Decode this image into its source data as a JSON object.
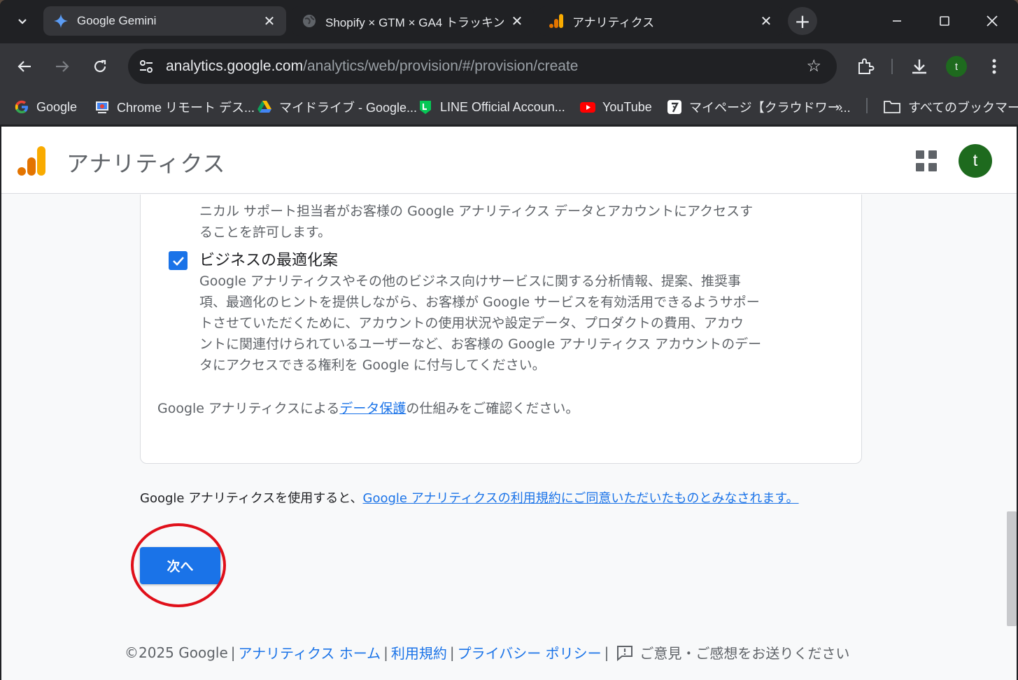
{
  "tabs": [
    {
      "title": "Google Gemini",
      "icon": "gemini-icon"
    },
    {
      "title": "Shopify × GTM × GA4 トラッキン",
      "icon": "globe-icon"
    },
    {
      "title": "アナリティクス",
      "icon": "analytics-icon"
    }
  ],
  "address_bar": {
    "host": "analytics.google.com",
    "path": "/analytics/web/provision/#/provision/create"
  },
  "profile": {
    "initial": "t",
    "color": "#1e6a1e"
  },
  "bookmarks": [
    {
      "label": "Google",
      "icon": "google-icon"
    },
    {
      "label": "Chrome リモート デス...",
      "icon": "chrome-remote-icon"
    },
    {
      "label": "マイドライブ - Google...",
      "icon": "drive-icon"
    },
    {
      "label": "LINE Official Accoun...",
      "icon": "line-icon"
    },
    {
      "label": "YouTube",
      "icon": "youtube-icon"
    },
    {
      "label": "マイページ【クラウドワー...",
      "icon": "crowdworks-icon"
    }
  ],
  "bookmarks_overflow": "»",
  "all_bookmarks": "すべてのブックマーク",
  "app": {
    "title": "アナリティクス"
  },
  "options": {
    "previous_desc_tail": "ニカル サポート担当者がお客様の Google アナリティクス データとアカウントにアクセスすることを許可します。",
    "previous_desc_line1": "ニカル サポート担当者がお客様の Google アナリティクス データとアカウントにアクセスす",
    "previous_desc_line2": "ることを許可します。",
    "business_title": "ビジネスの最適化案",
    "business_checked": true,
    "business_desc": [
      "Google アナリティクスやその他のビジネス向けサービスに関する分析情報、提案、推奨事",
      "項、最適化のヒントを提供しながら、お客様が Google サービスを有効活用できるようサポー",
      "トさせていただくために、アカウントの使用状況や設定データ、プロダクトの費用、アカウ",
      "ントに関連付けられているユーザーなど、お客様の Google アナリティクス アカウントのデー",
      "タにアクセスできる権利を Google に付与してください。"
    ],
    "protection_prefix": "Google アナリティクスによる",
    "protection_link": "データ保護",
    "protection_suffix": "の仕組みをご確認ください。"
  },
  "terms": {
    "prefix": "Google アナリティクスを使用すると、",
    "link": "Google アナリティクスの利用規約にご同意いただいたものとみなされます。"
  },
  "next_button": "次へ",
  "footer": {
    "copyright": "©2025 Google",
    "links": [
      "アナリティクス ホーム",
      "利用規約",
      "プライバシー ポリシー"
    ],
    "feedback": "ご意見・ご感想をお送りください"
  },
  "colors": {
    "accent": "#1a73e8",
    "annotation": "#e0101a"
  }
}
